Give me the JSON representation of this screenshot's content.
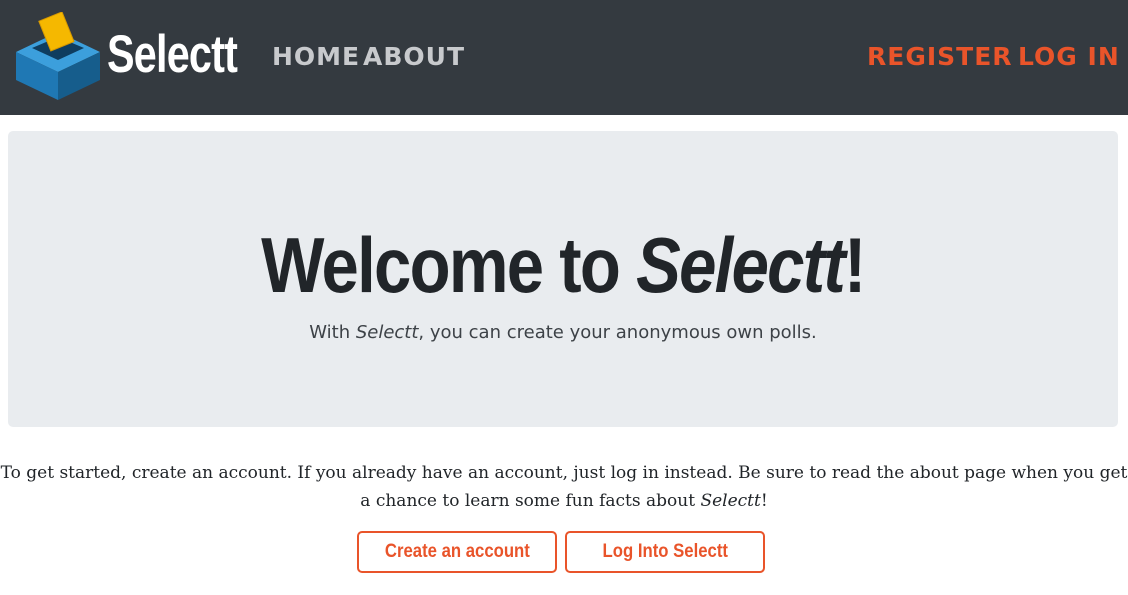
{
  "navbar": {
    "brand": "Selectt",
    "links": {
      "home": "HOME",
      "about": "ABOUT",
      "register": "REGISTER",
      "login": "LOG IN"
    },
    "colors": {
      "background": "#343a40",
      "link": "#c8cacd",
      "accent": "#e9542a"
    },
    "logo_icon": "ballot-box-icon"
  },
  "hero": {
    "title_prefix": "Welcome to ",
    "title_brand": "Selectt",
    "title_suffix": "!",
    "subtitle_prefix": "With ",
    "subtitle_brand": "Selectt",
    "subtitle_suffix": ", you can create your anonymous own polls.",
    "background": "#e9ecef"
  },
  "intro": {
    "text_main": "To get started, create an account. If you already have an account, just log in instead. Be sure to read the about page when you get a chance to learn some fun facts about ",
    "brand": "Selectt",
    "suffix": "!"
  },
  "buttons": {
    "create_account": "Create an account",
    "log_into": "Log Into Selectt"
  }
}
